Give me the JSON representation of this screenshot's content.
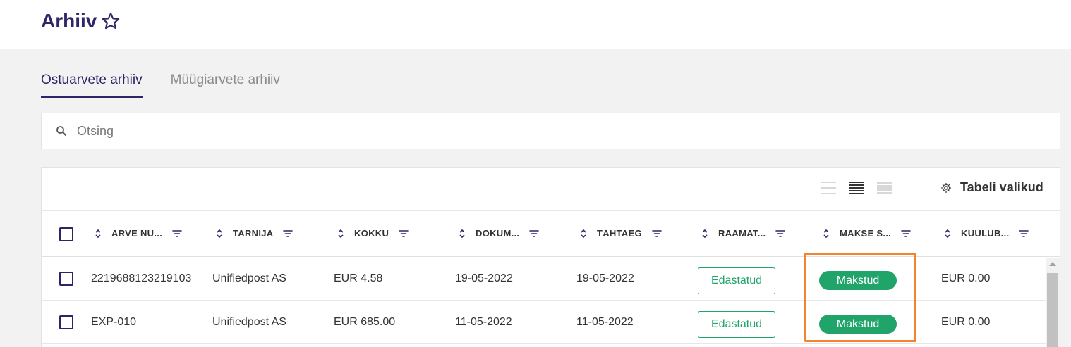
{
  "page": {
    "title": "Arhiiv"
  },
  "tabs": [
    {
      "label": "Ostuarvete arhiiv",
      "active": true
    },
    {
      "label": "Müügiarvete arhiiv",
      "active": false
    }
  ],
  "search": {
    "placeholder": "Otsing",
    "value": ""
  },
  "toolbar": {
    "table_options_label": "Tabeli valikud",
    "density_selected": "medium"
  },
  "columns": [
    {
      "label": "ARVE NU..."
    },
    {
      "label": "TARNIJA"
    },
    {
      "label": "KOKKU"
    },
    {
      "label": "DOKUM..."
    },
    {
      "label": "TÄHTAEG"
    },
    {
      "label": "RAAMAT..."
    },
    {
      "label": "MAKSE S..."
    },
    {
      "label": "KUULUB..."
    }
  ],
  "rows": [
    {
      "invoice_no": "2219688123219103",
      "supplier": "Unifiedpost AS",
      "total": "EUR 4.58",
      "doc_date": "19-05-2022",
      "due_date": "19-05-2022",
      "accounting": "Edastatud",
      "payment_status": "Makstud",
      "outstanding": "EUR 0.00"
    },
    {
      "invoice_no": "EXP-010",
      "supplier": "Unifiedpost AS",
      "total": "EUR 685.00",
      "doc_date": "11-05-2022",
      "due_date": "11-05-2022",
      "accounting": "Edastatud",
      "payment_status": "Makstud",
      "outstanding": "EUR 0.00"
    }
  ],
  "colors": {
    "brand": "#2d2566",
    "success": "#20a469",
    "highlight": "#f4832b"
  }
}
